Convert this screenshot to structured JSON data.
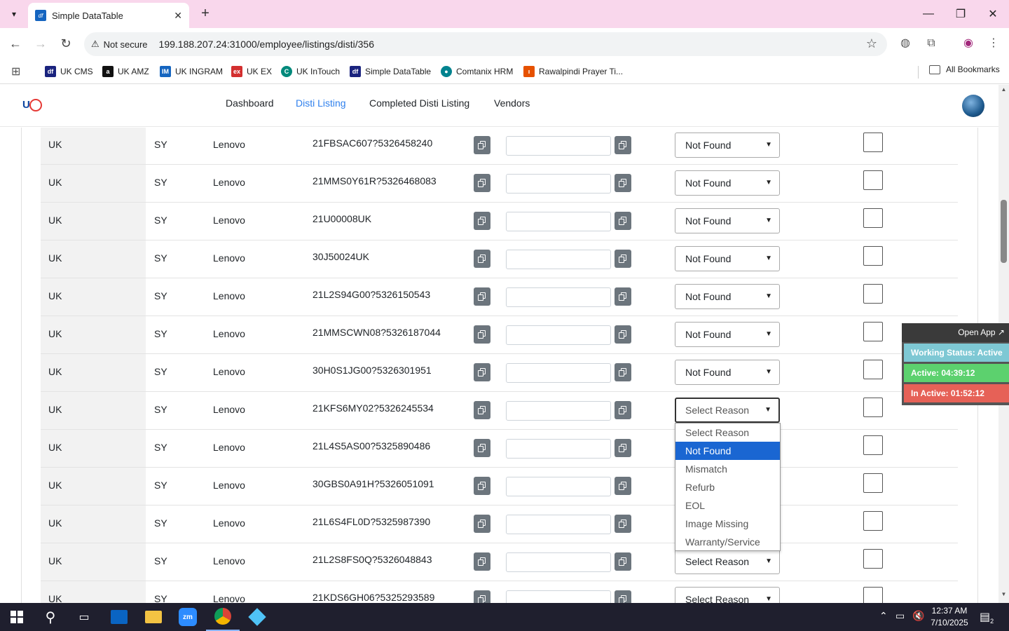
{
  "browser": {
    "tab_title": "Simple DataTable",
    "tab_favicon": "df",
    "security_label": "Not secure",
    "url": "199.188.207.24:31000/employee/listings/disti/356"
  },
  "bookmarks": {
    "items": [
      {
        "label": "UK CMS",
        "icon": "df",
        "color": "#1a237e"
      },
      {
        "label": "UK AMZ",
        "icon": "a",
        "color": "#111111"
      },
      {
        "label": "UK INGRAM",
        "icon": "IM",
        "color": "#1565c0"
      },
      {
        "label": "UK EX",
        "icon": "ex",
        "color": "#d32f2f"
      },
      {
        "label": "UK InTouch",
        "icon": "C",
        "color": "#00897b"
      },
      {
        "label": "Simple DataTable",
        "icon": "df",
        "color": "#1a237e"
      },
      {
        "label": "Comtanix HRM",
        "icon": "●",
        "color": "#00838f"
      },
      {
        "label": "Rawalpindi Prayer Ti...",
        "icon": "ı",
        "color": "#e65100"
      }
    ],
    "all_label": "All Bookmarks"
  },
  "nav": {
    "links": [
      "Dashboard",
      "Disti Listing",
      "Completed Disti Listing",
      "Vendors"
    ],
    "active": "Disti Listing"
  },
  "table": {
    "rows": [
      {
        "country": "UK",
        "code": "SY",
        "vendor": "Lenovo",
        "sku": "21FBSAC607?5326458240",
        "reason": "Not Found"
      },
      {
        "country": "UK",
        "code": "SY",
        "vendor": "Lenovo",
        "sku": "21MMS0Y61R?5326468083",
        "reason": "Not Found"
      },
      {
        "country": "UK",
        "code": "SY",
        "vendor": "Lenovo",
        "sku": "21U00008UK",
        "reason": "Not Found"
      },
      {
        "country": "UK",
        "code": "SY",
        "vendor": "Lenovo",
        "sku": "30J50024UK",
        "reason": "Not Found"
      },
      {
        "country": "UK",
        "code": "SY",
        "vendor": "Lenovo",
        "sku": "21L2S94G00?5326150543",
        "reason": "Not Found"
      },
      {
        "country": "UK",
        "code": "SY",
        "vendor": "Lenovo",
        "sku": "21MMSCWN08?5326187044",
        "reason": "Not Found"
      },
      {
        "country": "UK",
        "code": "SY",
        "vendor": "Lenovo",
        "sku": "30H0S1JG00?5326301951",
        "reason": "Not Found"
      },
      {
        "country": "UK",
        "code": "SY",
        "vendor": "Lenovo",
        "sku": "21KFS6MY02?5326245534",
        "reason": "Select Reason",
        "open": true
      },
      {
        "country": "UK",
        "code": "SY",
        "vendor": "Lenovo",
        "sku": "21L4S5AS00?5325890486",
        "reason": ""
      },
      {
        "country": "UK",
        "code": "SY",
        "vendor": "Lenovo",
        "sku": "30GBS0A91H?5326051091",
        "reason": ""
      },
      {
        "country": "UK",
        "code": "SY",
        "vendor": "Lenovo",
        "sku": "21L6S4FL0D?5325987390",
        "reason": ""
      },
      {
        "country": "UK",
        "code": "SY",
        "vendor": "Lenovo",
        "sku": "21L2S8FS0Q?5326048843",
        "reason": "Select Reason"
      },
      {
        "country": "UK",
        "code": "SY",
        "vendor": "Lenovo",
        "sku": "21KDS6GH06?5325293589",
        "reason": "Select Reason"
      }
    ]
  },
  "dropdown": {
    "options": [
      "Select Reason",
      "Not Found",
      "Mismatch",
      "Refurb",
      "EOL",
      "Image Missing",
      "Warranty/Service"
    ],
    "highlighted": "Not Found"
  },
  "status_widget": {
    "open_app": "Open App ↗",
    "working": "Working Status: Active",
    "active": "Active: 04:39:12",
    "inactive": "In Active: 01:52:12"
  },
  "taskbar": {
    "time": "12:37 AM",
    "date": "7/10/2025",
    "notifications": "2"
  }
}
